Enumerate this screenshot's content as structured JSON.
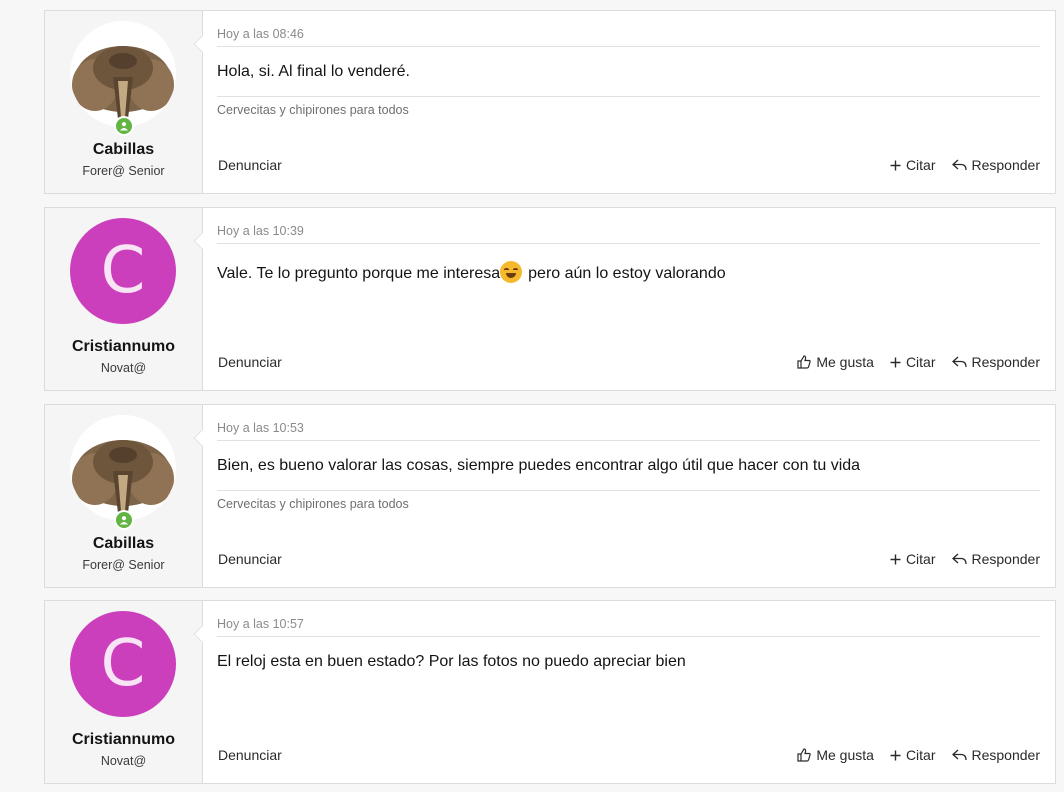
{
  "posts": [
    {
      "user": {
        "name": "Cabillas",
        "title": "Forer@ Senior",
        "avatar_type": "photo",
        "online": true
      },
      "date": "Hoy a las 08:46",
      "message": "Hola, si. Al final lo venderé.",
      "signature": "Cervecitas y chipirones para todos",
      "actions": {
        "report": "Denunciar",
        "quote": "Citar",
        "reply": "Responder"
      }
    },
    {
      "user": {
        "name": "Cristiannumo",
        "title": "Novat@",
        "avatar_type": "letter",
        "avatar_letter": "C",
        "avatar_color": "#cc3fbc"
      },
      "date": "Hoy a las 10:39",
      "message_before": "Vale. Te lo pregunto porque me interesa",
      "message_after": "pero aún lo estoy valorando",
      "emoji": "smiling-face-emoji",
      "actions": {
        "report": "Denunciar",
        "like": "Me gusta",
        "quote": "Citar",
        "reply": "Responder"
      }
    },
    {
      "user": {
        "name": "Cabillas",
        "title": "Forer@ Senior",
        "avatar_type": "photo",
        "online": true
      },
      "date": "Hoy a las 10:53",
      "message": "Bien, es bueno valorar las cosas, siempre puedes encontrar algo útil que hacer con tu vida",
      "signature": "Cervecitas y chipirones para todos",
      "actions": {
        "report": "Denunciar",
        "quote": "Citar",
        "reply": "Responder"
      }
    },
    {
      "user": {
        "name": "Cristiannumo",
        "title": "Novat@",
        "avatar_type": "letter",
        "avatar_letter": "C",
        "avatar_color": "#cc3fbc"
      },
      "date": "Hoy a las 10:57",
      "message": "El reloj esta en buen estado? Por las fotos no puedo apreciar bien",
      "actions": {
        "report": "Denunciar",
        "like": "Me gusta",
        "quote": "Citar",
        "reply": "Responder"
      }
    }
  ],
  "icons": {
    "plus": "plus-icon",
    "reply": "reply-arrow-icon",
    "like": "thumbs-up-icon",
    "online": "online-user-icon"
  },
  "colors": {
    "avatar_magenta": "#cc3fbc",
    "online_green": "#63b543"
  }
}
